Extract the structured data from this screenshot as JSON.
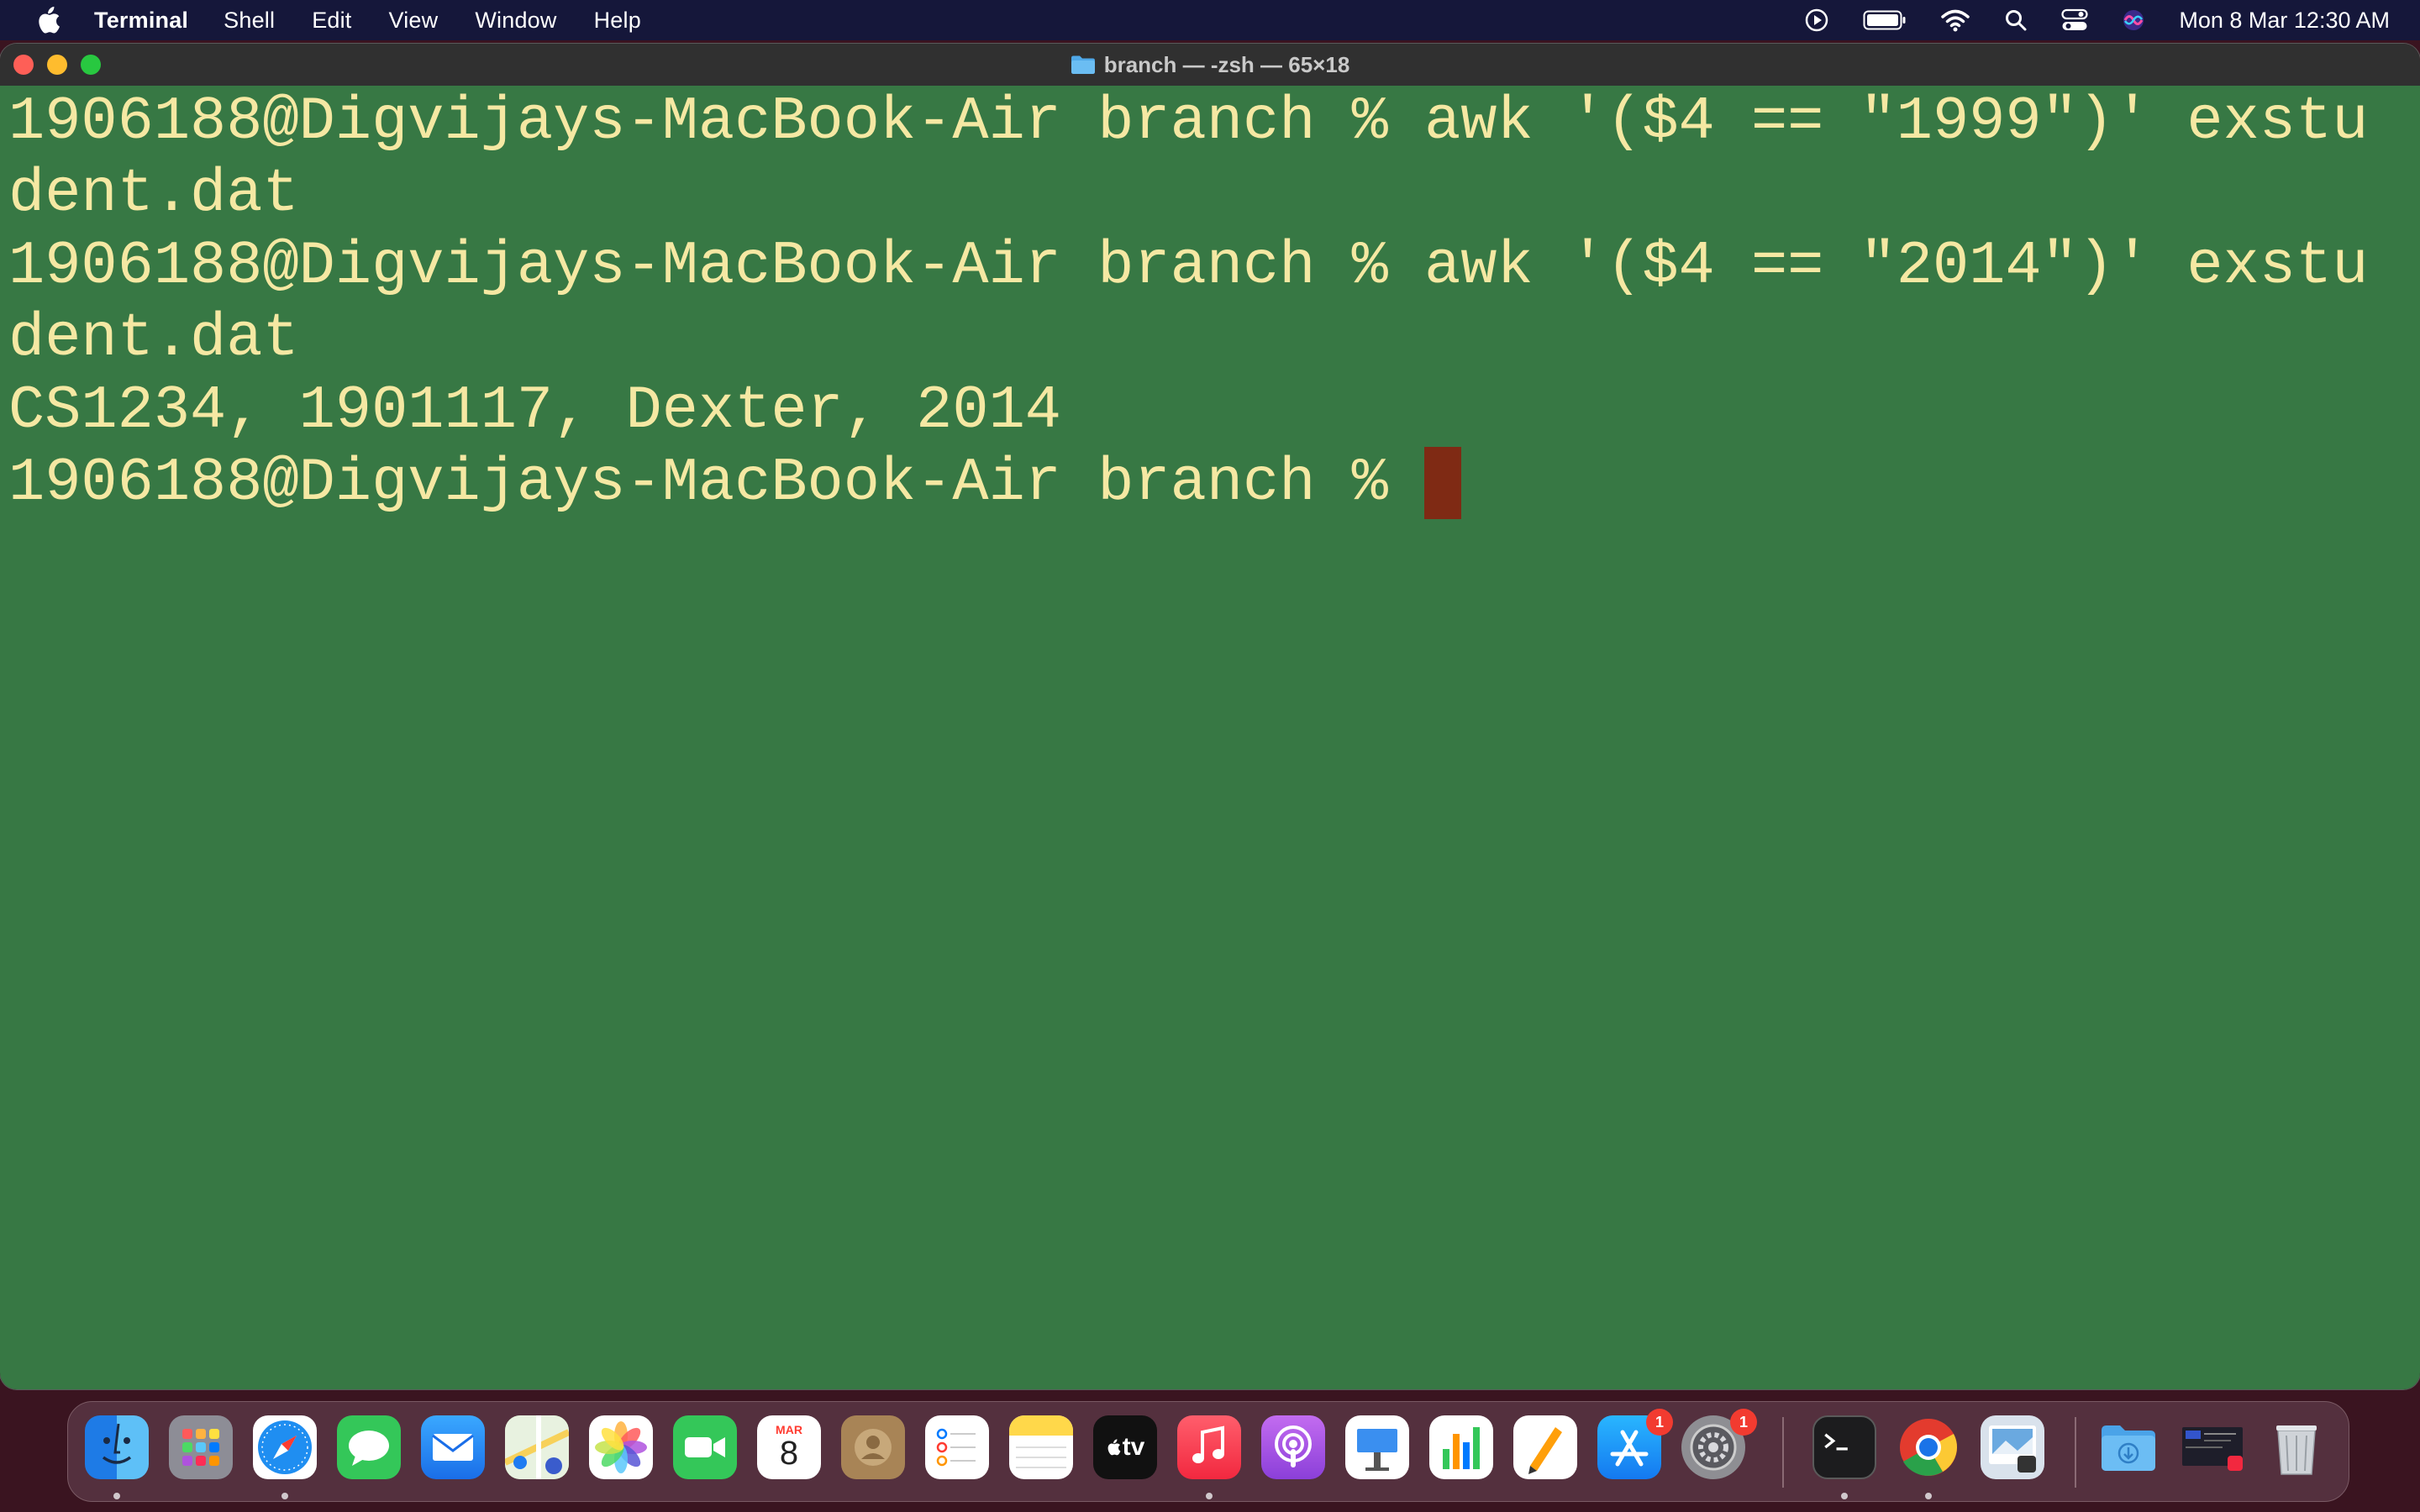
{
  "menubar": {
    "app_name": "Terminal",
    "items": [
      "Shell",
      "Edit",
      "View",
      "Window",
      "Help"
    ],
    "clock": "Mon 8 Mar  12:30 AM"
  },
  "window": {
    "title": "branch — -zsh — 65×18"
  },
  "terminal": {
    "lines": [
      "1906188@Digvijays-MacBook-Air branch % awk '($4 == \"1999\")' exstu",
      "dent.dat",
      "1906188@Digvijays-MacBook-Air branch % awk '($4 == \"2014\")' exstu",
      "dent.dat",
      "CS1234, 1901117, Dexter, 2014",
      "1906188@Digvijays-MacBook-Air branch % "
    ]
  },
  "dock": {
    "calendar_month": "MAR",
    "calendar_day": "8",
    "appstore_badge": "1",
    "settings_badge": "1",
    "tv_label": "tv"
  },
  "colors": {
    "terminal_bg": "#377844",
    "terminal_fg": "#f5e8a3",
    "cursor": "#7f2a14"
  }
}
